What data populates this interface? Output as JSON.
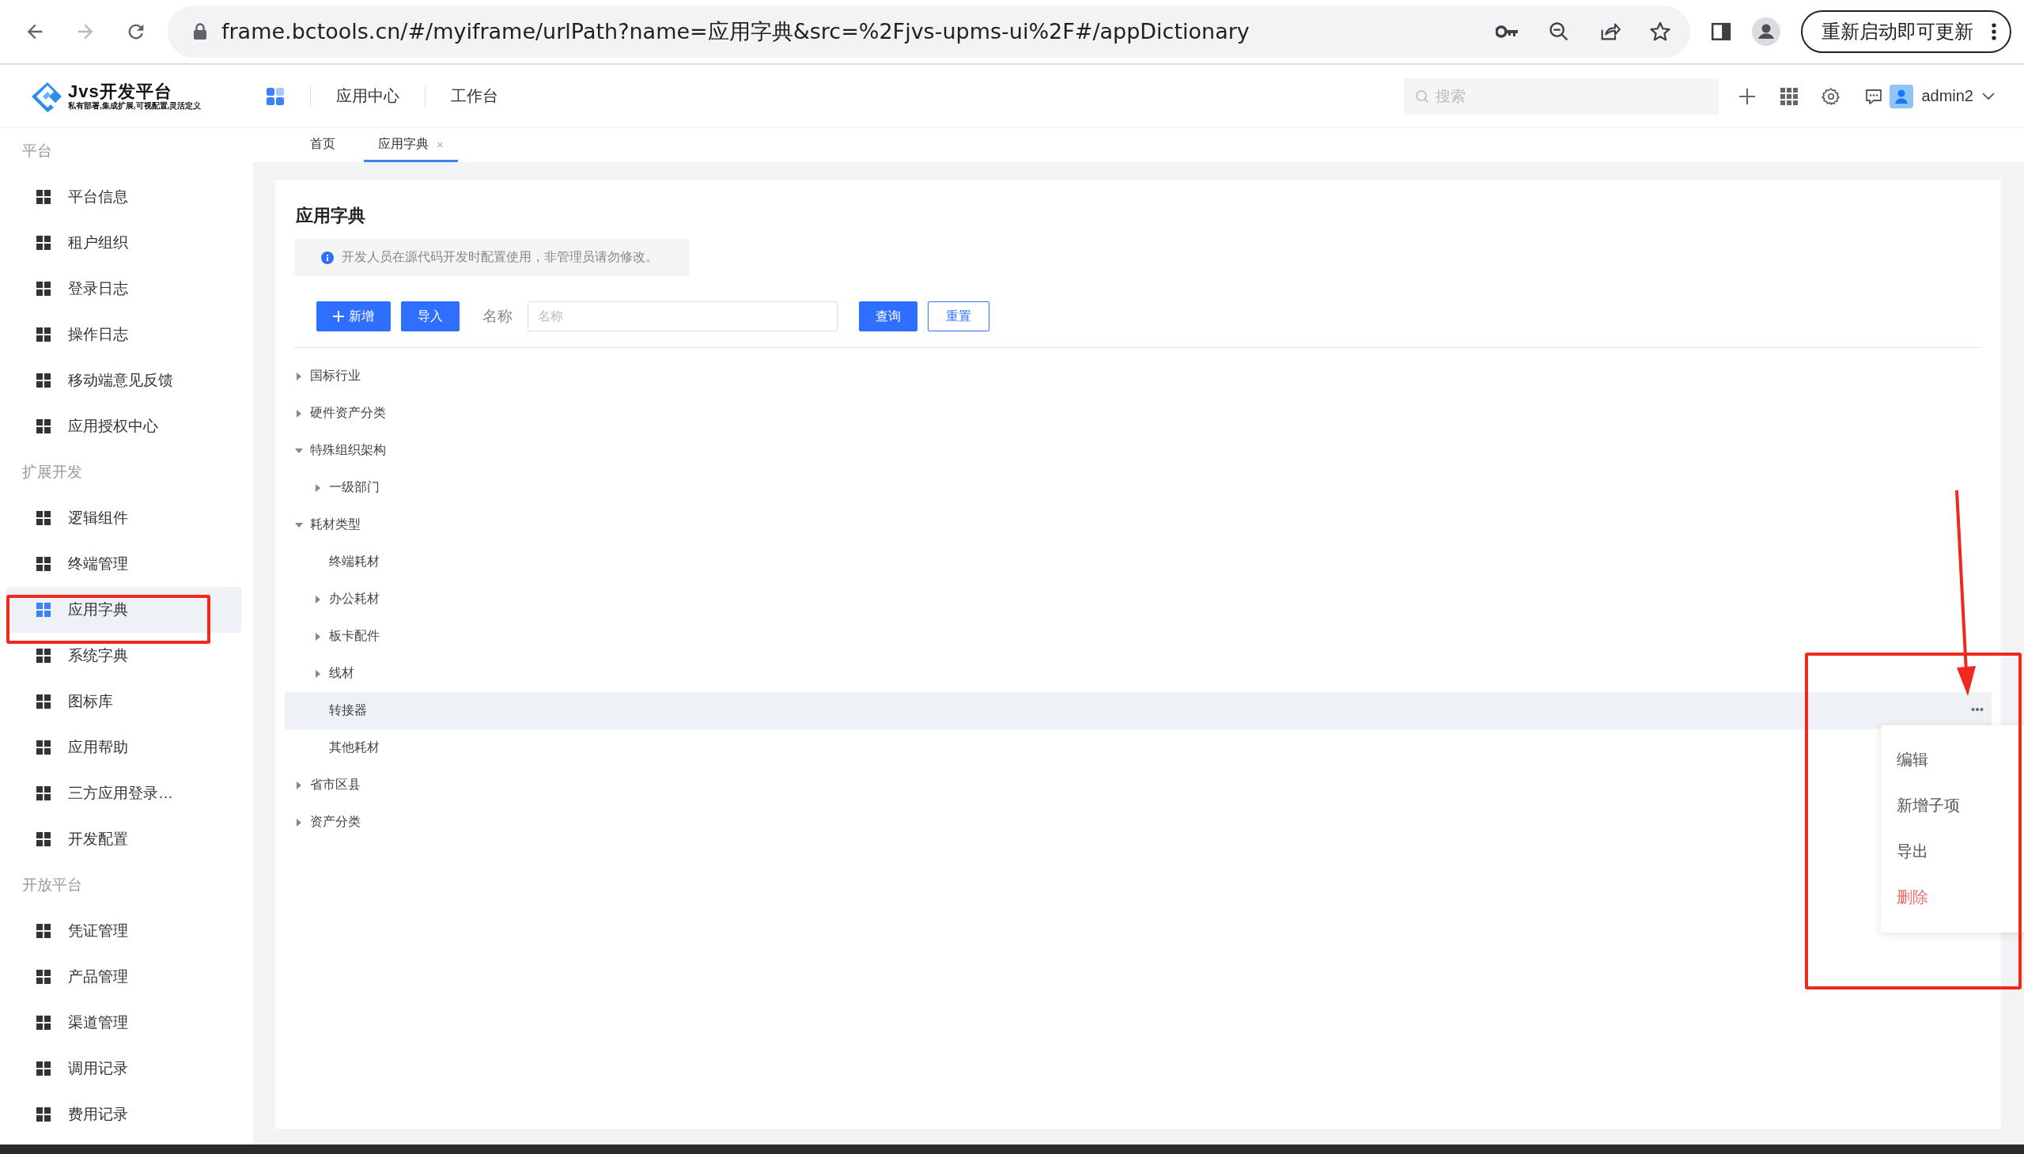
{
  "browser": {
    "url": "frame.bctools.cn/#/myiframe/urlPath?name=应用字典&src=%2Fjvs-upms-ui%2F#/appDictionary",
    "update_button": "重新启动即可更新"
  },
  "header": {
    "logo_title": "Jvs开发平台",
    "logo_subtitle": "私有部署,集成扩展,可视配置,灵活定义",
    "nav": [
      {
        "label": "应用中心"
      },
      {
        "label": "工作台"
      }
    ],
    "search_placeholder": "搜索",
    "user": "admin2"
  },
  "sidebar": {
    "sections": [
      {
        "title": "平台",
        "items": [
          {
            "label": "平台信息",
            "selected": false
          },
          {
            "label": "租户组织",
            "selected": false
          },
          {
            "label": "登录日志",
            "selected": false
          },
          {
            "label": "操作日志",
            "selected": false
          },
          {
            "label": "移动端意见反馈",
            "selected": false
          },
          {
            "label": "应用授权中心",
            "selected": false
          }
        ]
      },
      {
        "title": "扩展开发",
        "items": [
          {
            "label": "逻辑组件",
            "selected": false
          },
          {
            "label": "终端管理",
            "selected": false
          },
          {
            "label": "应用字典",
            "selected": true
          },
          {
            "label": "系统字典",
            "selected": false
          },
          {
            "label": "图标库",
            "selected": false
          },
          {
            "label": "应用帮助",
            "selected": false
          },
          {
            "label": "三方应用登录…",
            "selected": false
          },
          {
            "label": "开发配置",
            "selected": false
          }
        ]
      },
      {
        "title": "开放平台",
        "items": [
          {
            "label": "凭证管理",
            "selected": false
          },
          {
            "label": "产品管理",
            "selected": false
          },
          {
            "label": "渠道管理",
            "selected": false
          },
          {
            "label": "调用记录",
            "selected": false
          },
          {
            "label": "费用记录",
            "selected": false
          }
        ]
      }
    ]
  },
  "tabs": [
    {
      "label": "首页",
      "selected": false
    },
    {
      "label": "应用字典",
      "selected": true,
      "close": "×"
    }
  ],
  "page": {
    "title": "应用字典",
    "notice": "开发人员在源代码开发时配置使用，非管理员请勿修改。",
    "toolbar": {
      "add_button": "新增",
      "import_button": "导入",
      "filter_label": "名称",
      "filter_placeholder": "名称",
      "query_button": "查询",
      "reset_button": "重置"
    },
    "tree": [
      {
        "label": "国标行业",
        "kind": "branch",
        "expanded": false,
        "selected": false
      },
      {
        "label": "硬件资产分类",
        "kind": "branch",
        "expanded": false,
        "selected": false
      },
      {
        "label": "特殊组织架构",
        "kind": "branch",
        "expanded": true,
        "selected": false,
        "children": [
          {
            "label": "一级部门",
            "kind": "branch",
            "expanded": false,
            "selected": false
          }
        ]
      },
      {
        "label": "耗材类型",
        "kind": "branch",
        "expanded": true,
        "selected": false,
        "children": [
          {
            "label": "终端耗材",
            "kind": "leaf",
            "selected": false
          },
          {
            "label": "办公耗材",
            "kind": "branch",
            "expanded": false,
            "selected": false
          },
          {
            "label": "板卡配件",
            "kind": "branch",
            "expanded": false,
            "selected": false
          },
          {
            "label": "线材",
            "kind": "branch",
            "expanded": false,
            "selected": false
          },
          {
            "label": "转接器",
            "kind": "leaf",
            "selected": true
          },
          {
            "label": "其他耗材",
            "kind": "leaf",
            "selected": false
          }
        ]
      },
      {
        "label": "省市区县",
        "kind": "branch",
        "expanded": false,
        "selected": false
      },
      {
        "label": "资产分类",
        "kind": "branch",
        "expanded": false,
        "selected": false
      }
    ],
    "row_menu": [
      {
        "label": "编辑",
        "kind": "normal"
      },
      {
        "label": "新增子项",
        "kind": "normal"
      },
      {
        "label": "导出",
        "kind": "normal"
      },
      {
        "label": "删除",
        "kind": "danger"
      }
    ]
  },
  "annotations": [
    {
      "kind": "box"
    },
    {
      "kind": "box"
    },
    {
      "kind": "arrow"
    }
  ]
}
